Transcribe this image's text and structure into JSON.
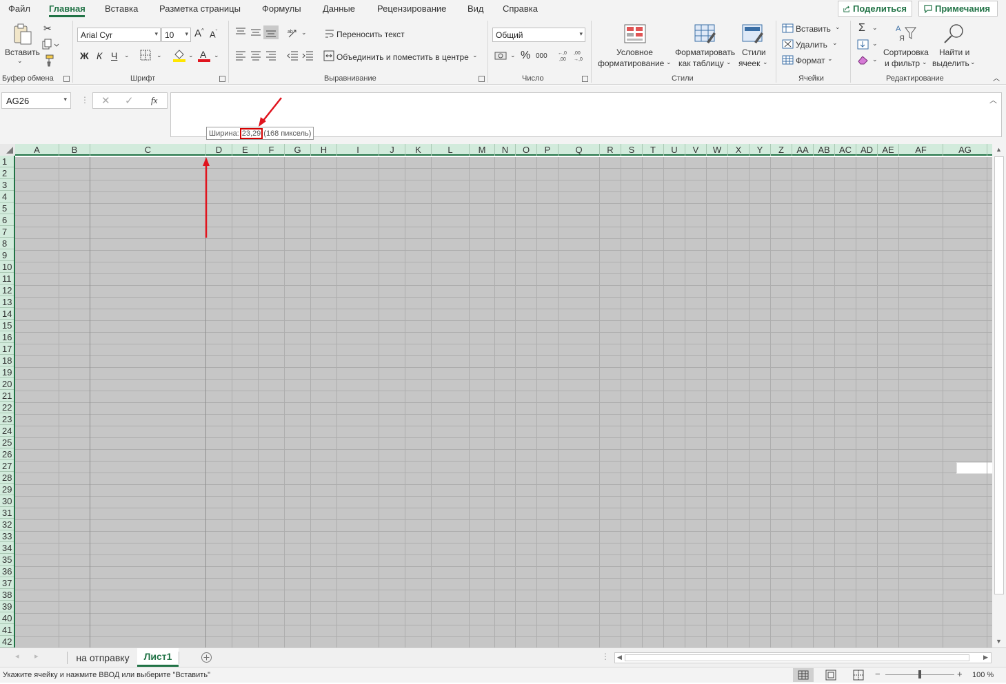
{
  "menu": {
    "tabs": [
      "Файл",
      "Главная",
      "Вставка",
      "Разметка страницы",
      "Формулы",
      "Данные",
      "Рецензирование",
      "Вид",
      "Справка"
    ],
    "active_tab": "Главная",
    "share_label": "Поделиться",
    "comments_label": "Примечания"
  },
  "ribbon": {
    "clipboard": {
      "paste_label": "Вставить",
      "group_label": "Буфер обмена"
    },
    "font": {
      "name": "Arial Cyr",
      "size": "10",
      "bold": "Ж",
      "italic": "К",
      "underline": "Ч",
      "increase": "A",
      "decrease": "A",
      "group_label": "Шрифт"
    },
    "alignment": {
      "wrap_text": "Переносить текст",
      "merge_center": "Объединить и поместить в центре",
      "group_label": "Выравнивание"
    },
    "number": {
      "format": "Общий",
      "percent": "%",
      "thousands": "000",
      "group_label": "Число"
    },
    "styles": {
      "conditional": [
        "Условное",
        "форматирование"
      ],
      "format_table": [
        "Форматировать",
        "как таблицу"
      ],
      "cell_styles": [
        "Стили",
        "ячеек"
      ],
      "group_label": "Стили"
    },
    "cells": {
      "insert": "Вставить",
      "delete": "Удалить",
      "format": "Формат",
      "group_label": "Ячейки"
    },
    "editing": {
      "sort_filter": [
        "Сортировка",
        "и фильтр"
      ],
      "find_select": [
        "Найти и",
        "выделить"
      ],
      "group_label": "Редактирование"
    }
  },
  "formula_bar": {
    "name_box": "AG26",
    "fx": "fx",
    "value": ""
  },
  "tooltip": {
    "prefix": "Ширина:",
    "value": "23,29",
    "pixels": "(168 пиксель)"
  },
  "columns": [
    "A",
    "B",
    "C",
    "D",
    "E",
    "F",
    "G",
    "H",
    "I",
    "J",
    "K",
    "L",
    "M",
    "N",
    "O",
    "P",
    "Q",
    "R",
    "S",
    "T",
    "U",
    "V",
    "W",
    "X",
    "Y",
    "Z",
    "AA",
    "AB",
    "AC",
    "AD",
    "AE",
    "AF",
    "AG"
  ],
  "rows": [
    "1",
    "2",
    "3",
    "4",
    "5",
    "6",
    "7",
    "8",
    "9",
    "10",
    "11",
    "12",
    "13",
    "14",
    "15",
    "16",
    "17",
    "18",
    "19",
    "20",
    "21",
    "22",
    "23",
    "24",
    "25",
    "26",
    "27",
    "28",
    "29",
    "30",
    "31",
    "32",
    "33",
    "34",
    "35",
    "36",
    "37",
    "38",
    "39",
    "40",
    "41",
    "42"
  ],
  "sheet_tabs": [
    "на отправку",
    "Лист1"
  ],
  "active_sheet": "Лист1",
  "status": {
    "message": "Укажите ячейку и нажмите ВВОД или выберите \"Вставить\"",
    "zoom": "100 %"
  },
  "colors": {
    "accent": "#217346",
    "annotation": "#e0141e",
    "grid_fill": "#c6c6c6"
  }
}
